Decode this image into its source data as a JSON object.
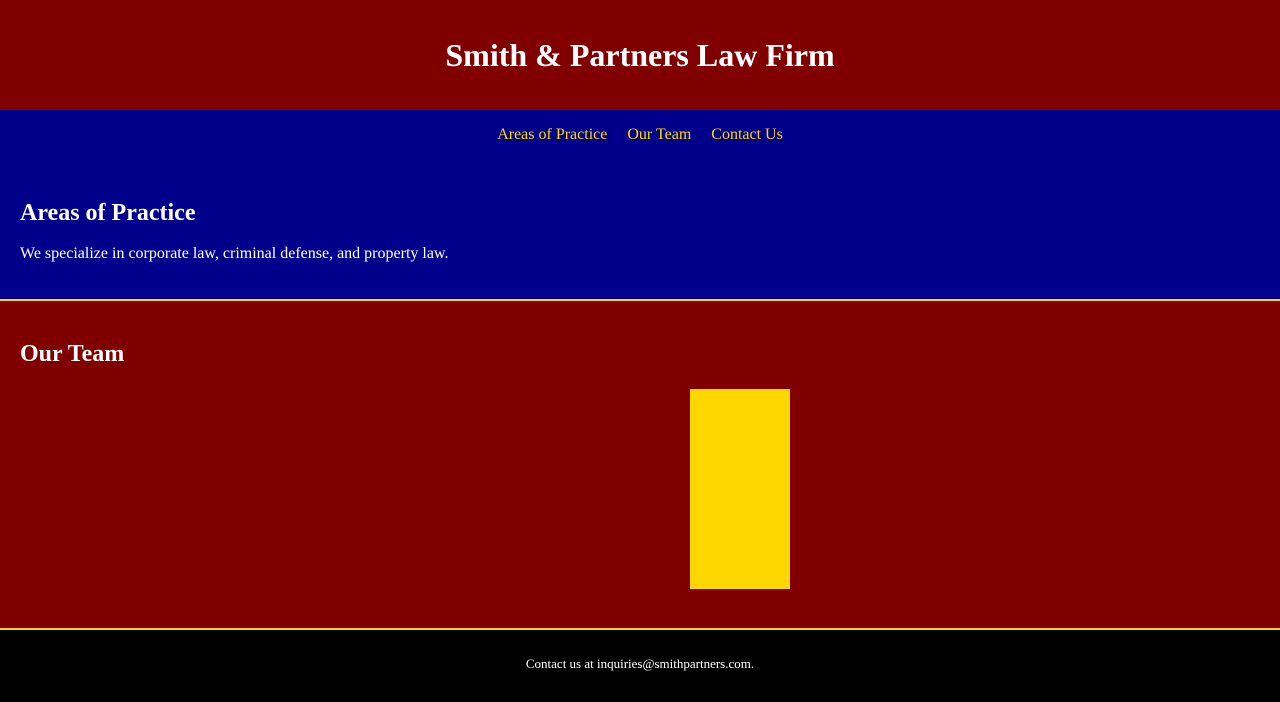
{
  "header": {
    "title": "Smith & Partners Law Firm"
  },
  "nav": {
    "items": [
      {
        "label": "Areas of Practice"
      },
      {
        "label": "Our Team"
      },
      {
        "label": "Contact Us"
      }
    ]
  },
  "practice": {
    "heading": "Areas of Practice",
    "text": "We specialize in corporate law, criminal defense, and property law."
  },
  "team": {
    "heading": "Our Team"
  },
  "footer": {
    "text": "Contact us at inquiries@smithpartners.com."
  },
  "colors": {
    "header_bg": "#800000",
    "nav_bg": "#00008b",
    "link": "#ffd700",
    "accent_border": "#ffd700",
    "team_photo": "#ffd700",
    "footer_bg": "#000000"
  }
}
